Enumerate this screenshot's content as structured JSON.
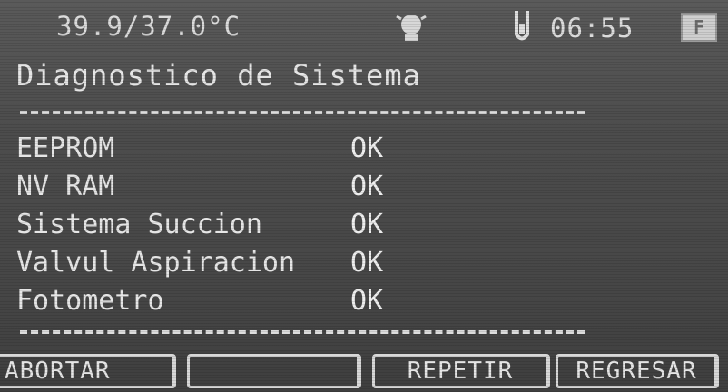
{
  "status_bar": {
    "temperature": "39.9/37.0°C",
    "lamp_icon": "lamp-icon",
    "tube_icon": "test-tube-icon",
    "time": "06:55",
    "badge": "F"
  },
  "title": "Diagnostico de Sistema",
  "diagnostics": [
    {
      "label": "EEPROM",
      "status": "OK"
    },
    {
      "label": "NV RAM",
      "status": "OK"
    },
    {
      "label": "Sistema Succion",
      "status": "OK"
    },
    {
      "label": "Valvul Aspiracion",
      "status": "OK"
    },
    {
      "label": "Fotometro",
      "status": "OK"
    }
  ],
  "softkeys": {
    "k1": "ABORTAR",
    "k2": "",
    "k3": "REPETIR",
    "k4": "REGRESAR"
  },
  "colors": {
    "screen_bg": "#4c4c4c",
    "text": "#e6e6e6"
  }
}
